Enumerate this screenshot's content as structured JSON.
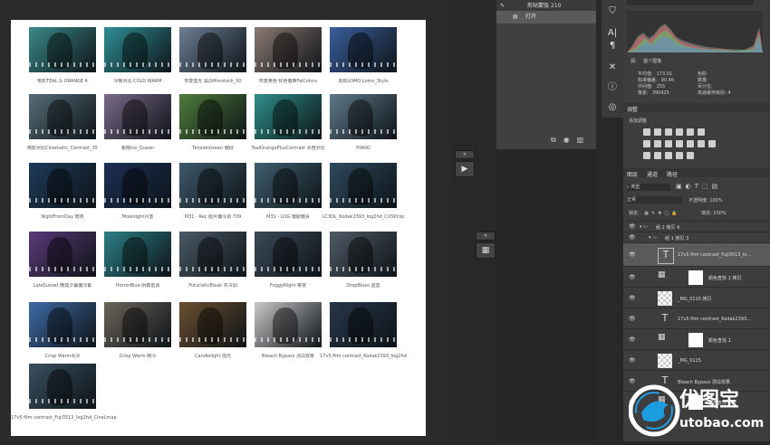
{
  "presets": [
    {
      "label": "电影TEAL & ORANGE 4",
      "tint": "#3a8a8a"
    },
    {
      "label": "冷暖对比 COLD WARM",
      "tint": "#2f8f96"
    },
    {
      "label": "恢复蓝光 黑白filmstock_50",
      "tint": "#6d7f93"
    },
    {
      "label": "恢复黄色 标色偏黄FalColors",
      "tint": "#8c7a72"
    },
    {
      "label": "再现LOMO Lomo_Style",
      "tint": "#3a5f9c"
    },
    {
      "label": "电影对比Cinematic_Contrast_35",
      "tint": "#566e7a"
    },
    {
      "label": "紫樱Ice_Queen",
      "tint": "#7a6a8a"
    },
    {
      "label": "TensionGreen 偏绿",
      "tint": "#4f7d3c"
    },
    {
      "label": "TealOrangePlusContrast 青橙对比",
      "tint": "#2f8f8a"
    },
    {
      "label": "PIANO",
      "tint": "#5f7a8a"
    },
    {
      "label": "NightFromDay 暗夜",
      "tint": "#1e3a5a"
    },
    {
      "label": "Moonlight月蓝",
      "tint": "#1c2f55"
    },
    {
      "label": "M31 - Rec 胶片偏冷调 709",
      "tint": "#3f5a6a"
    },
    {
      "label": "M31 - LOG 偏胶偏青",
      "tint": "#3f5f6f"
    },
    {
      "label": "LC3DL_Kodak2393_log2hd_CUSPclip",
      "tint": "#2e4a5e"
    },
    {
      "label": "LateSunset 晚霞夕暮偏冷紫",
      "tint": "#5a3a7a"
    },
    {
      "label": "HorrorBlue 阴森蓝调",
      "tint": "#2d7f86"
    },
    {
      "label": "FuturisticBleak 灰冷调",
      "tint": "#4a5a66"
    },
    {
      "label": "FoggyNight 雾夜",
      "tint": "#3c4a58"
    },
    {
      "label": "DropBlues 蓝蓝",
      "tint": "#4f5a66"
    },
    {
      "label": "Crisp Warm青冷",
      "tint": "#3f6aa6"
    },
    {
      "label": "Crisp Warm 暖冷",
      "tint": "#6a655a"
    },
    {
      "label": "Candlelight 烛光",
      "tint": "#6a4f30"
    },
    {
      "label": "Bleach Bypass 漂白效果",
      "tint": "#c8c8c8"
    },
    {
      "label": "17v5 film contrast_Kodak2393_log2hd_CineLmap",
      "tint": "#28364a"
    },
    {
      "label": "17v5 film contrast_Fuji3513_log2hd_CineLmap",
      "tint": "#3a5060"
    }
  ],
  "history": {
    "title_item": "剪贴蒙版 210",
    "open_item": "打开"
  },
  "histogram_panel": {
    "source_label": "源:",
    "source_value": "整个图像",
    "stats": [
      {
        "label": "平均值:",
        "value": "173.01"
      },
      {
        "label": "标准偏差:",
        "value": "90.46"
      },
      {
        "label": "中间值:",
        "value": "255"
      },
      {
        "label": "像素:",
        "value": "390425"
      }
    ],
    "stats_right": [
      "色阶:",
      "数量:",
      "百分位:",
      "高速缓存级别: 4"
    ]
  },
  "adjustments": {
    "title": "调整",
    "add_label": "添加调整"
  },
  "layers_panel": {
    "tabs": [
      "图层",
      "通道",
      "路径"
    ],
    "kind_label": "类型",
    "blend_mode": "正常",
    "opacity_label": "不透明度:",
    "opacity_value": "100%",
    "lock_label": "锁定:",
    "fill_label": "填充:",
    "fill_value": "100%",
    "layers": [
      {
        "name": "组 2 拷贝 4",
        "type": "group",
        "indent": 0
      },
      {
        "name": "组 1 拷贝 3",
        "type": "group",
        "indent": 1
      },
      {
        "name": "17v5 film contrast_Fuji3513_lo...",
        "type": "text",
        "indent": 2
      },
      {
        "name": "颜色查找 1 拷贝",
        "type": "adjust",
        "indent": 2
      },
      {
        "name": "_MG_0115 拷贝",
        "type": "image",
        "indent": 2
      },
      {
        "name": "17v5 film contrast_Kodak2393...",
        "type": "text",
        "indent": 2
      },
      {
        "name": "颜色查找 1",
        "type": "adjust",
        "indent": 2
      },
      {
        "name": "_MG_0115",
        "type": "image",
        "indent": 2
      },
      {
        "name": "Bleach Bypass 漂白效果",
        "type": "text",
        "indent": 2
      },
      {
        "name": "颜色查找 1",
        "type": "adjust",
        "indent": 2
      }
    ]
  },
  "watermark": {
    "brand": "优图宝",
    "domain": "utobao.com"
  }
}
